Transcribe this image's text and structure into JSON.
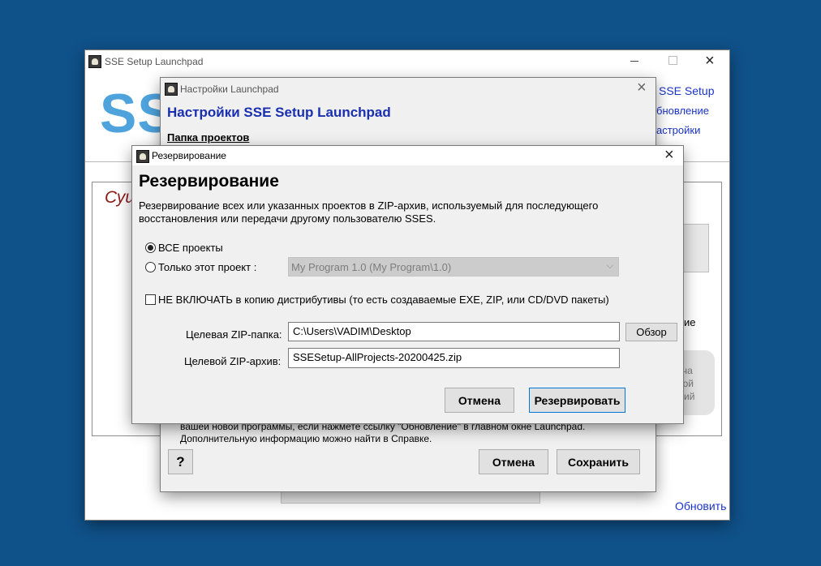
{
  "main_window": {
    "title": "SSE Setup Launchpad",
    "logo": "SSE",
    "links": {
      "setup": "SSE Setup",
      "update": "бновление",
      "settings": "астройки"
    },
    "partial_heading": "Сущ",
    "right_fragments": {
      "line1": "ие",
      "line2": "атча",
      "line3": "ной",
      "line4": "сий"
    },
    "bottom_link": "Обновить"
  },
  "settings_dialog": {
    "title": "Настройки Launchpad",
    "heading": "Настройки SSE Setup Launchpad",
    "section": "Папка проектов",
    "info_line1": "вашей новой программы, если нажмете ссылку \"Обновление\" в главном окне Launchpad.",
    "info_line2": "Дополнительную информацию можно найти в Справке.",
    "help_label": "?",
    "cancel_label": "Отмена",
    "save_label": "Сохранить"
  },
  "backup_dialog": {
    "title": "Резервирование",
    "heading": "Резервирование",
    "description_line1": "Резервирование всех или указанных проектов в ZIP-архив, используемый для последующего",
    "description_line2": "восстановления или передачи другому пользователю SSES.",
    "radio_all_label": "ВСЕ проекты",
    "radio_this_label": "Только этот проект :",
    "selected_radio": "all",
    "project_select_value": "My Program 1.0 (My Program\\1.0)",
    "exclude_checkbox_label": "НЕ ВКЛЮЧАТЬ в копию дистрибутивы (то есть создаваемые EXE, ZIP, или CD/DVD пакеты)",
    "exclude_checked": false,
    "zip_folder_label": "Целевая ZIP-папка:",
    "zip_folder_value": "C:\\Users\\VADIM\\Desktop",
    "browse_label": "Обзор",
    "zip_archive_label": "Целевой ZIP-архив:",
    "zip_archive_value": "SSESetup-AllProjects-20200425.zip",
    "cancel_label": "Отмена",
    "backup_label": "Резервировать"
  },
  "colors": {
    "desktop": "#0f5189",
    "logo_blue": "#4ea3dd",
    "heading_blue": "#1a2fb0",
    "link_blue": "#1a33c8",
    "partial_heading": "#8b1a1a"
  }
}
